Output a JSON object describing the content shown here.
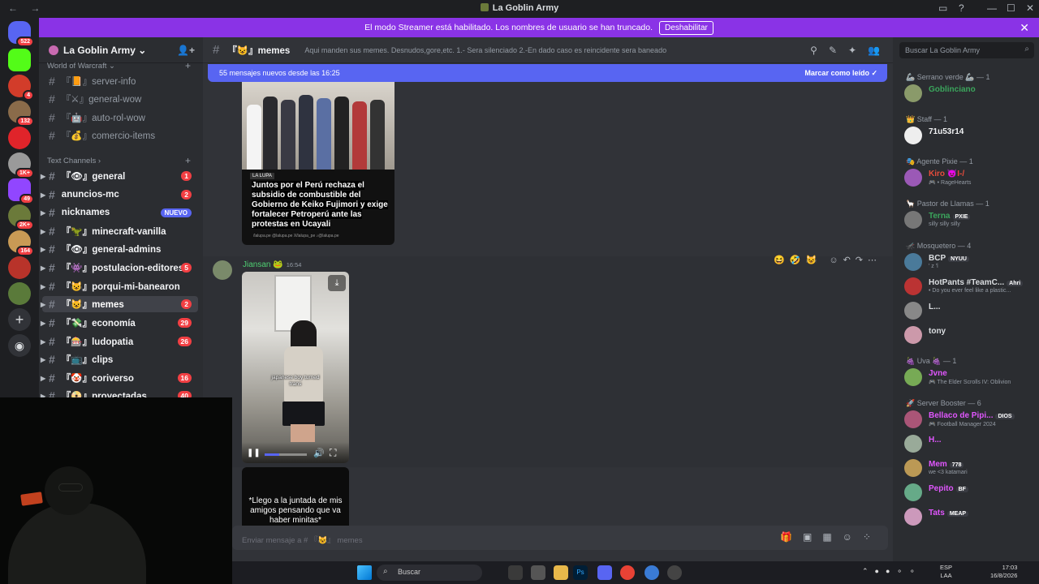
{
  "window": {
    "title": "La Goblin Army",
    "nav_back": "←",
    "nav_fwd": "→"
  },
  "banner": {
    "text": "El modo Streamer está habilitado. Los nombres de usuario se han truncado.",
    "button": "Deshabilitar"
  },
  "server_rail": {
    "badges": [
      "522",
      "4",
      "132",
      "1K+",
      "49",
      "2K+",
      "164"
    ]
  },
  "server": {
    "name": "La Goblin Army",
    "categories": {
      "wow": "World of Warcraft",
      "text": "Text Channels"
    },
    "wow_channels": [
      "『📙』server-info",
      "『⚔』general-wow",
      "『🤖』auto-rol-wow",
      "『💰』comercio-items"
    ],
    "channels": [
      {
        "label": "『👁』general",
        "count": "1"
      },
      {
        "label": "anuncios-mc",
        "count": "2"
      },
      {
        "label": "nicknames",
        "new": "NUEVO"
      },
      {
        "label": "『🦖』minecraft-vanilla",
        "count": ""
      },
      {
        "label": "『👁』general-admins",
        "count": ""
      },
      {
        "label": "『👾』postulacion-editores",
        "count": "5"
      },
      {
        "label": "『😺』porqui-mi-banearon",
        "count": ""
      },
      {
        "label": "『😺』memes",
        "count": "2"
      },
      {
        "label": "『💸』economía",
        "count": "29"
      },
      {
        "label": "『🎰』ludopatia",
        "count": "26"
      },
      {
        "label": "『📺』clips",
        "count": ""
      },
      {
        "label": "『🤡』coriverso",
        "count": "16"
      },
      {
        "label": "『📀』proyectadas",
        "count": "40"
      }
    ]
  },
  "channel": {
    "name": "『😺』memes",
    "topic": "Aqui manden sus memes. Desnudos,gore,etc. 1.- Sera silenciado 2.-En dado caso es reincidente sera baneado",
    "new_messages": "55 mensajes nuevos desde las 16:25",
    "mark_read": "Marcar como leído",
    "composer_placeholder": "Enviar mensaje a # 『😺』 memes"
  },
  "messages": {
    "image1": {
      "tag": "LA LUPA",
      "headline": "Juntos por el Perú rechaza el subsidio de combustible del Gobierno de Keiko Fujimori y exige fortalecer Petroperú ante las protestas en Ucayali",
      "footer": "/lalupa.pe  @lalupa.pe  X/lalupa_pe  ♪@lalupa.pe"
    },
    "post": {
      "author": "Jiansan 🐸",
      "time": "16:54",
      "video_caption": "japanese boy turned trans",
      "progress": 0.35
    },
    "image3": {
      "text": "*Llego a la juntada de mis amigos pensando que va haber minitas*"
    }
  },
  "member_search": "Buscar La Goblin Army",
  "member_groups": [
    {
      "title": "🦾 Serrano verde 🦾 — 1",
      "members": [
        {
          "name": "Goblinciano",
          "color": "#3ba55c",
          "status": ""
        }
      ]
    },
    {
      "title": "👑 Staff — 1",
      "members": [
        {
          "name": "71u53r14",
          "color": "#f2f3f5",
          "status": ""
        }
      ]
    },
    {
      "title": "🎭 Agente Pixie — 1",
      "members": [
        {
          "name": "Kiro 😈I-/",
          "color": "#e74c3c",
          "status": "🎮 • RageHearts"
        }
      ]
    },
    {
      "title": "🦙 Pastor de Llamas — 1",
      "members": [
        {
          "name": "Terna",
          "badge": "PXIE",
          "color": "#3ba55c",
          "status": "silly silly silly"
        }
      ]
    },
    {
      "title": "🦟 Mosquetero — 4",
      "members": [
        {
          "name": "BCP",
          "badge": "NYUU",
          "color": "#dbdee1",
          "status": "' z 'l"
        },
        {
          "name": "HotPants #TeamC...",
          "badge": "Ahri",
          "color": "#dbdee1",
          "status": "• Do you ever feel like a plastic..."
        },
        {
          "name": "L...",
          "color": "#dbdee1",
          "status": ""
        },
        {
          "name": "tony",
          "color": "#dbdee1",
          "status": ""
        }
      ]
    },
    {
      "title": "🍇 Uva 🍇 — 1",
      "members": [
        {
          "name": "Jvne",
          "color": "#e056fd",
          "status": "🎮 The Elder Scrolls IV: Oblivion"
        }
      ]
    },
    {
      "title": "🚀 Server Booster — 6",
      "members": [
        {
          "name": "Bellaco de Pipi...",
          "badge": "DIOS",
          "color": "#e056fd",
          "status": "🎮 Football Manager 2024"
        },
        {
          "name": "H...",
          "color": "#e056fd",
          "status": ""
        },
        {
          "name": "Mem",
          "badge": "778",
          "color": "#e056fd",
          "status": "we <3 katamari"
        },
        {
          "name": "Pepito",
          "badge": "BF",
          "color": "#e056fd",
          "status": ""
        },
        {
          "name": "Tats",
          "badge": "MEAP",
          "color": "#e056fd",
          "status": ""
        }
      ]
    }
  ],
  "taskbar": {
    "search": "Buscar",
    "lang1": "ESP",
    "lang2": "LAA",
    "time": "17:03",
    "date": "16/8/2026"
  }
}
